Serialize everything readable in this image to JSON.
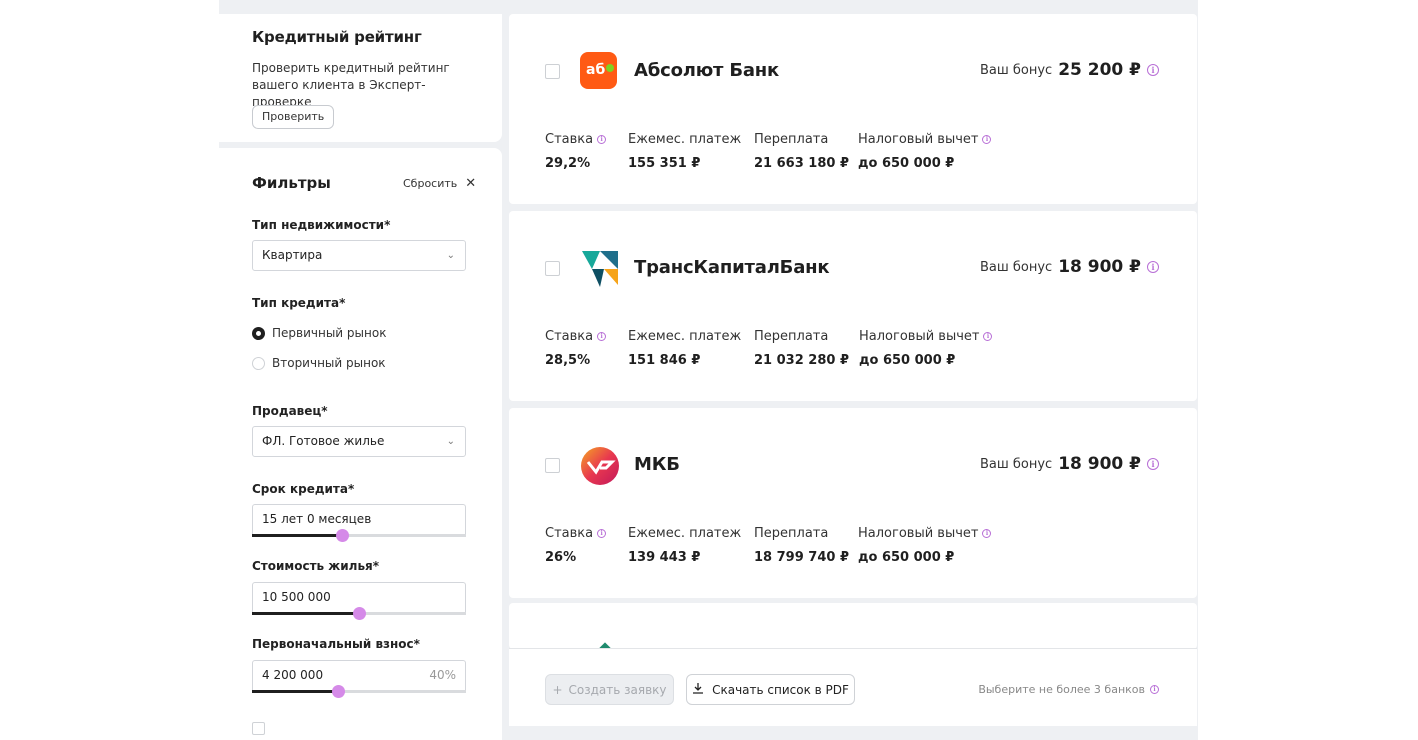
{
  "credit_rating": {
    "title": "Кредитный рейтинг",
    "description": "Проверить кредитный рейтинг вашего клиента в Эксперт-проверке",
    "check_button": "Проверить"
  },
  "filters": {
    "title": "Фильтры",
    "reset": "Сбросить",
    "property_type": {
      "label": "Тип недвижимости*",
      "value": "Квартира"
    },
    "credit_type": {
      "label": "Тип кредита*",
      "options": [
        {
          "label": "Первичный рынок",
          "selected": true
        },
        {
          "label": "Вторичный рынок",
          "selected": false
        }
      ]
    },
    "seller": {
      "label": "Продавец*",
      "value": "ФЛ. Готовое жилье"
    },
    "term": {
      "label": "Срок кредита*",
      "value": "15 лет 0 месяцев",
      "slider_percent": 42
    },
    "price": {
      "label": "Стоимость жилья*",
      "value": "10 500 000",
      "slider_percent": 50
    },
    "down_payment": {
      "label": "Первоначальный взнос*",
      "value": "4 200 000",
      "percent_text": "40%",
      "slider_percent": 40
    }
  },
  "stat_labels": {
    "rate": "Ставка",
    "monthly": "Ежемес. платеж",
    "overpay": "Переплата",
    "tax": "Налоговый вычет"
  },
  "bonus_label": "Ваш бонус",
  "banks": [
    {
      "name": "Абсолют Банк",
      "logo_text": "аб",
      "bonus": "25 200 ₽",
      "rate": "29,2%",
      "monthly": "155 351 ₽",
      "overpay": "21 663 180 ₽",
      "tax": "до 650 000 ₽"
    },
    {
      "name": "ТрансКапиталБанк",
      "bonus": "18 900 ₽",
      "rate": "28,5%",
      "monthly": "151 846 ₽",
      "overpay": "21 032 280 ₽",
      "tax": "до 650 000 ₽"
    },
    {
      "name": "МКБ",
      "bonus": "18 900 ₽",
      "rate": "26%",
      "monthly": "139 443 ₽",
      "overpay": "18 799 740 ₽",
      "tax": "до 650 000 ₽"
    }
  ],
  "bottom": {
    "create_button": "Создать заявку",
    "pdf_button": "Скачать список в PDF",
    "hint": "Выберите не более 3 банков"
  },
  "colors": {
    "accent": "#d58ae8",
    "info": "#b86fd6",
    "absolut": "#ff5a14"
  }
}
